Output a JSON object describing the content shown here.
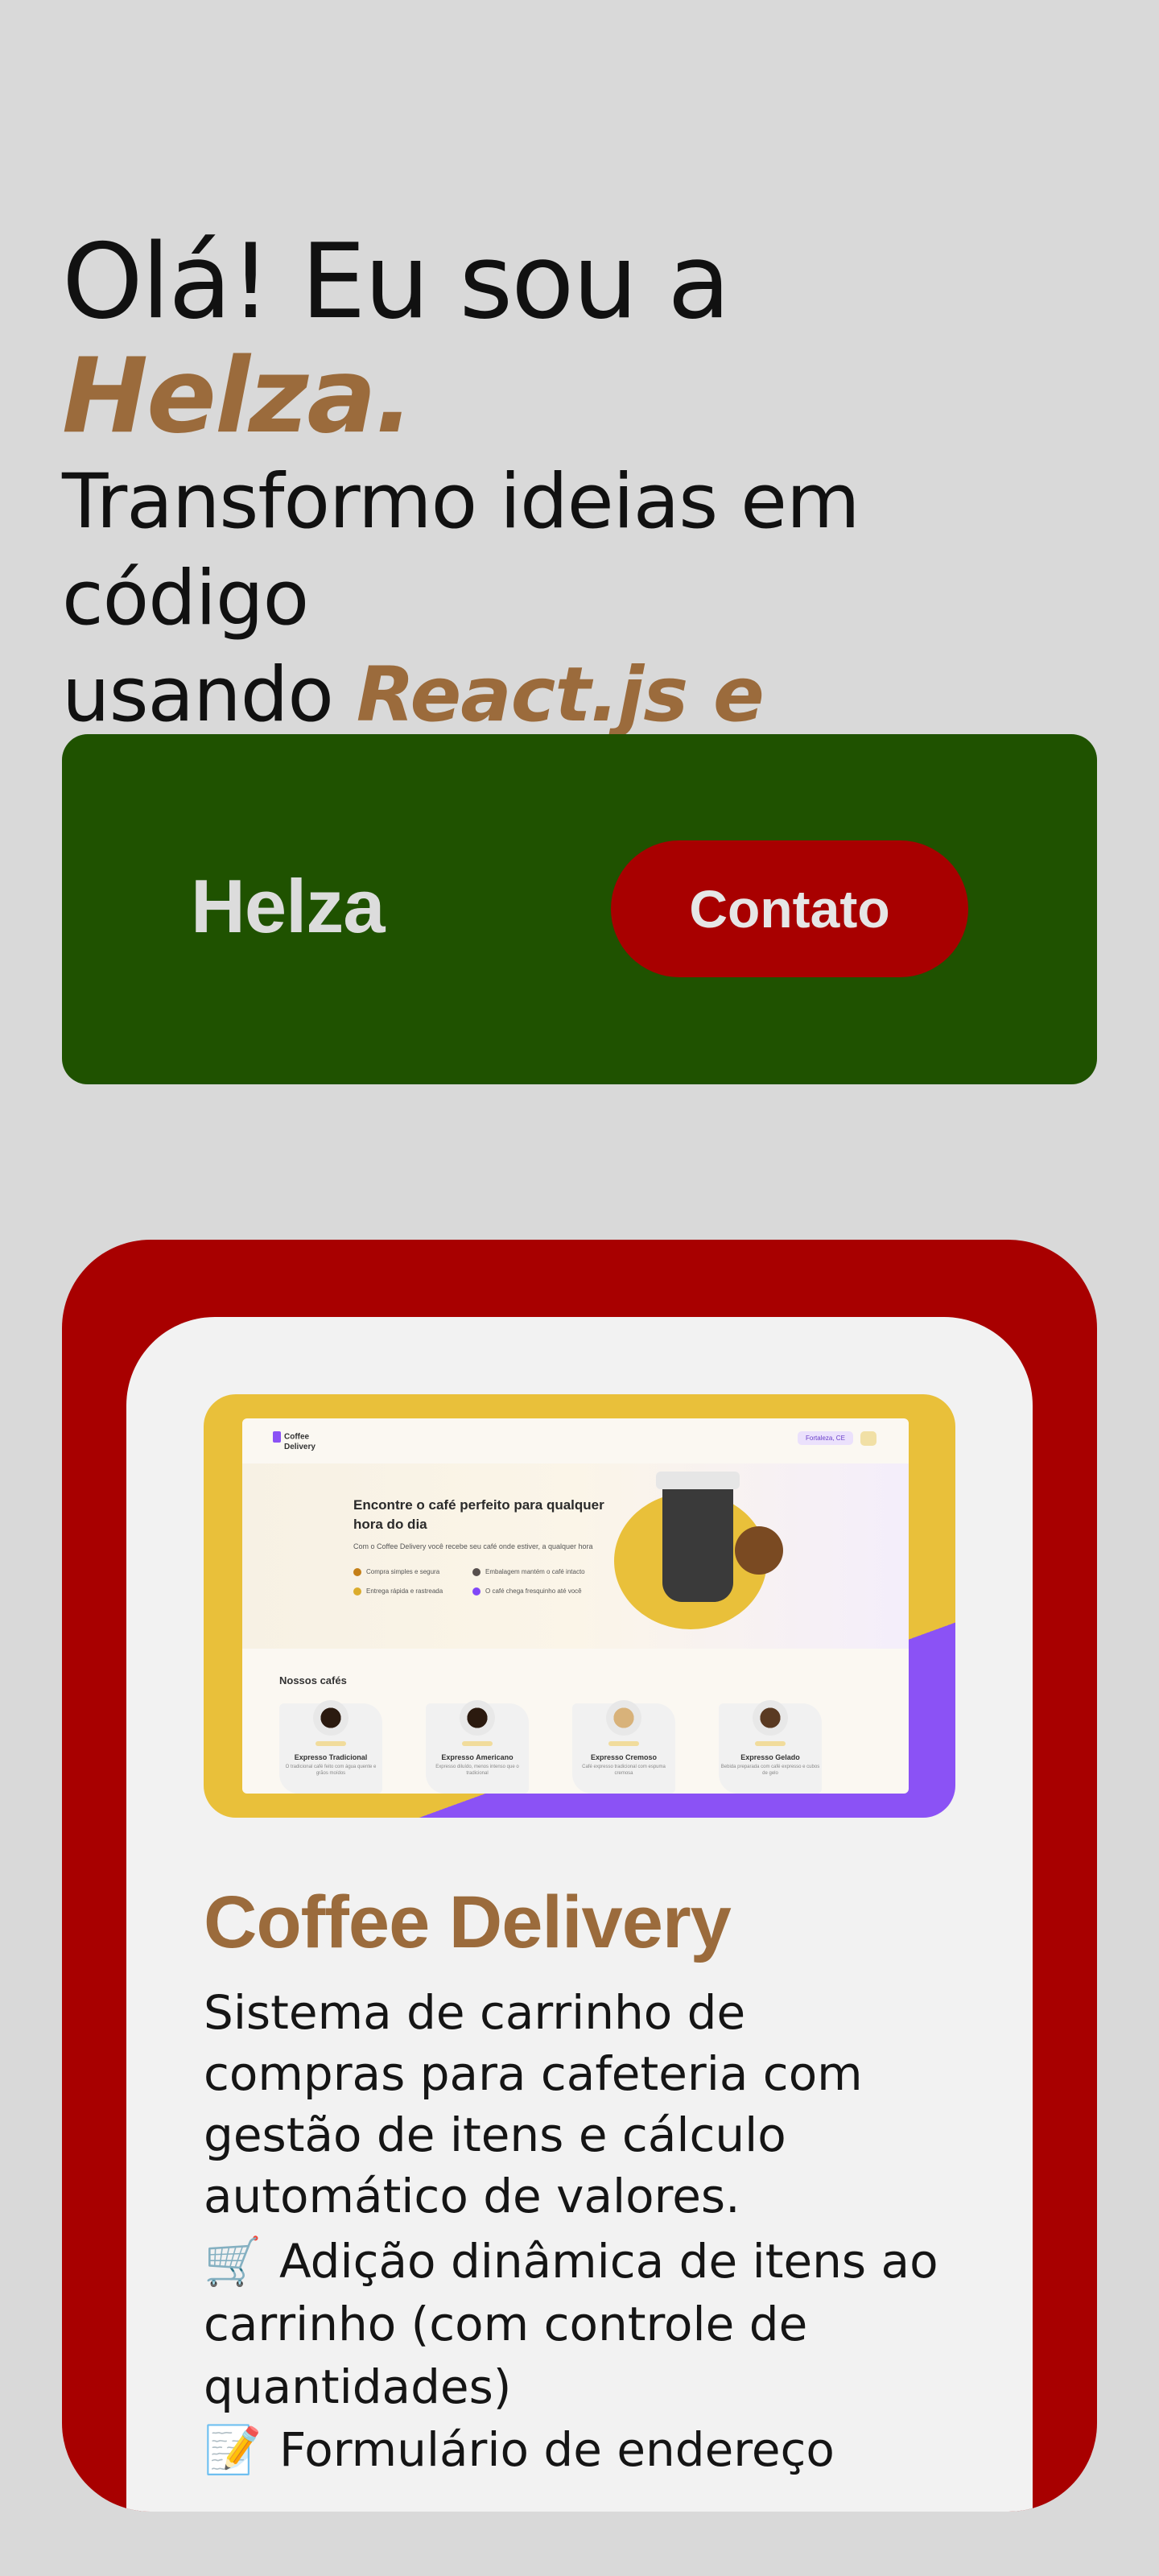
{
  "hero": {
    "line1_text": "Olá! Eu sou a ",
    "line1_accent": "Helza.",
    "line2_text": "Transformo ideias em código",
    "line3_text": "usando ",
    "line3_accent": "React.js e TypeScript."
  },
  "navbar": {
    "brand": "Helza",
    "contact_label": "Contato"
  },
  "project": {
    "title": "Coffee Delivery",
    "description": "Sistema de carrinho de compras para cafeteria com gestão de itens e cálculo automático de valores.",
    "features": [
      {
        "icon": "shopping-cart-icon",
        "glyph": "🛒",
        "text": "Adição dinâmica de itens ao carrinho (com controle de quantidades)"
      },
      {
        "icon": "memo-icon",
        "glyph": "📝",
        "text": "Formulário de endereço"
      }
    ],
    "thumbnail": {
      "logo_line1": "Coffee",
      "logo_line2": "Delivery",
      "location": "Fortaleza, CE",
      "headline": "Encontre o café perfeito para qualquer hora do dia",
      "subheadline": "Com o Coffee Delivery você recebe seu café onde estiver, a qualquer hora",
      "bullets": [
        "Compra simples e segura",
        "Embalagem mantém o café intacto",
        "Entrega rápida e rastreada",
        "O café chega fresquinho até você"
      ],
      "section_title": "Nossos cafés",
      "coffees": [
        {
          "name": "Expresso Tradicional",
          "desc": "O tradicional café feito com água quente e grãos moídos"
        },
        {
          "name": "Expresso Americano",
          "desc": "Expresso diluído, menos intenso que o tradicional"
        },
        {
          "name": "Expresso Cremoso",
          "desc": "Café expresso tradicional com espuma cremosa"
        },
        {
          "name": "Expresso Gelado",
          "desc": "Bebida preparada com café expresso e cubos de gelo"
        }
      ],
      "colors": {
        "yellow": "#e9c03a",
        "purple": "#8b52f5"
      }
    }
  },
  "colors": {
    "background": "#d9d9d9",
    "accent_brown": "#9b6b3c",
    "navbar_green": "#1f5200",
    "contact_red": "#a80000"
  }
}
